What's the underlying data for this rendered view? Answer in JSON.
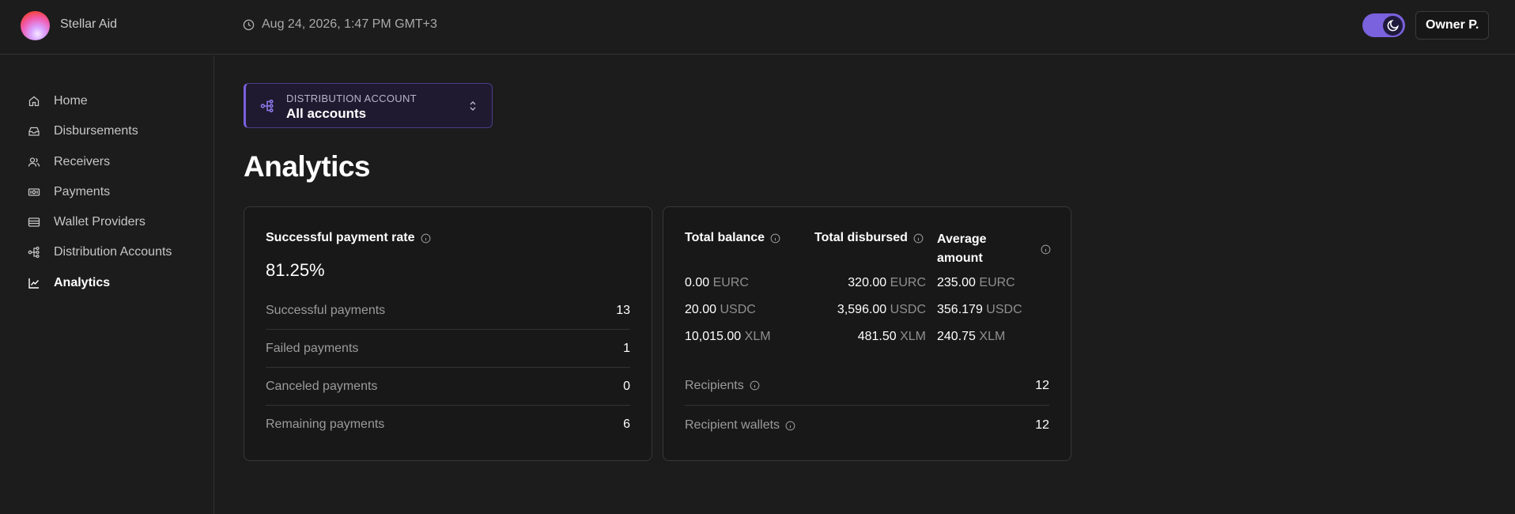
{
  "header": {
    "app_name": "Stellar Aid",
    "datetime": "Aug 24, 2026, 1:47 PM GMT+3",
    "user": "Owner P."
  },
  "sidebar": {
    "items": [
      {
        "label": "Home",
        "icon": "home-icon"
      },
      {
        "label": "Disbursements",
        "icon": "inbox-icon"
      },
      {
        "label": "Receivers",
        "icon": "users-icon"
      },
      {
        "label": "Payments",
        "icon": "money-icon"
      },
      {
        "label": "Wallet Providers",
        "icon": "wallet-icon"
      },
      {
        "label": "Distribution Accounts",
        "icon": "network-icon"
      },
      {
        "label": "Analytics",
        "icon": "chart-icon",
        "active": true
      }
    ]
  },
  "account_select": {
    "label": "DISTRIBUTION ACCOUNT",
    "value": "All accounts"
  },
  "page": {
    "title": "Analytics"
  },
  "payment_rate": {
    "title": "Successful payment rate",
    "value": "81.25%",
    "rows": [
      {
        "label": "Successful payments",
        "value": "13"
      },
      {
        "label": "Failed payments",
        "value": "1"
      },
      {
        "label": "Canceled payments",
        "value": "0"
      },
      {
        "label": "Remaining payments",
        "value": "6"
      }
    ]
  },
  "balances": {
    "headers": {
      "total_balance": "Total balance",
      "total_disbursed": "Total disbursed",
      "average_line1": "Average",
      "average_line2": "amount"
    },
    "rows": [
      {
        "balance": "0.00",
        "balance_cur": "EURC",
        "disbursed": "320.00",
        "disbursed_cur": "EURC",
        "avg": "235.00",
        "avg_cur": "EURC"
      },
      {
        "balance": "20.00",
        "balance_cur": "USDC",
        "disbursed": "3,596.00",
        "disbursed_cur": "USDC",
        "avg": "356.179",
        "avg_cur": "USDC"
      },
      {
        "balance": "10,015.00",
        "balance_cur": "XLM",
        "disbursed": "481.50",
        "disbursed_cur": "XLM",
        "avg": "240.75",
        "avg_cur": "XLM"
      }
    ],
    "summary": [
      {
        "label": "Recipients",
        "value": "12"
      },
      {
        "label": "Recipient wallets",
        "value": "12"
      }
    ]
  },
  "colors": {
    "accent": "#7a61dd",
    "background": "#1c1c1c",
    "card": "#181818"
  }
}
